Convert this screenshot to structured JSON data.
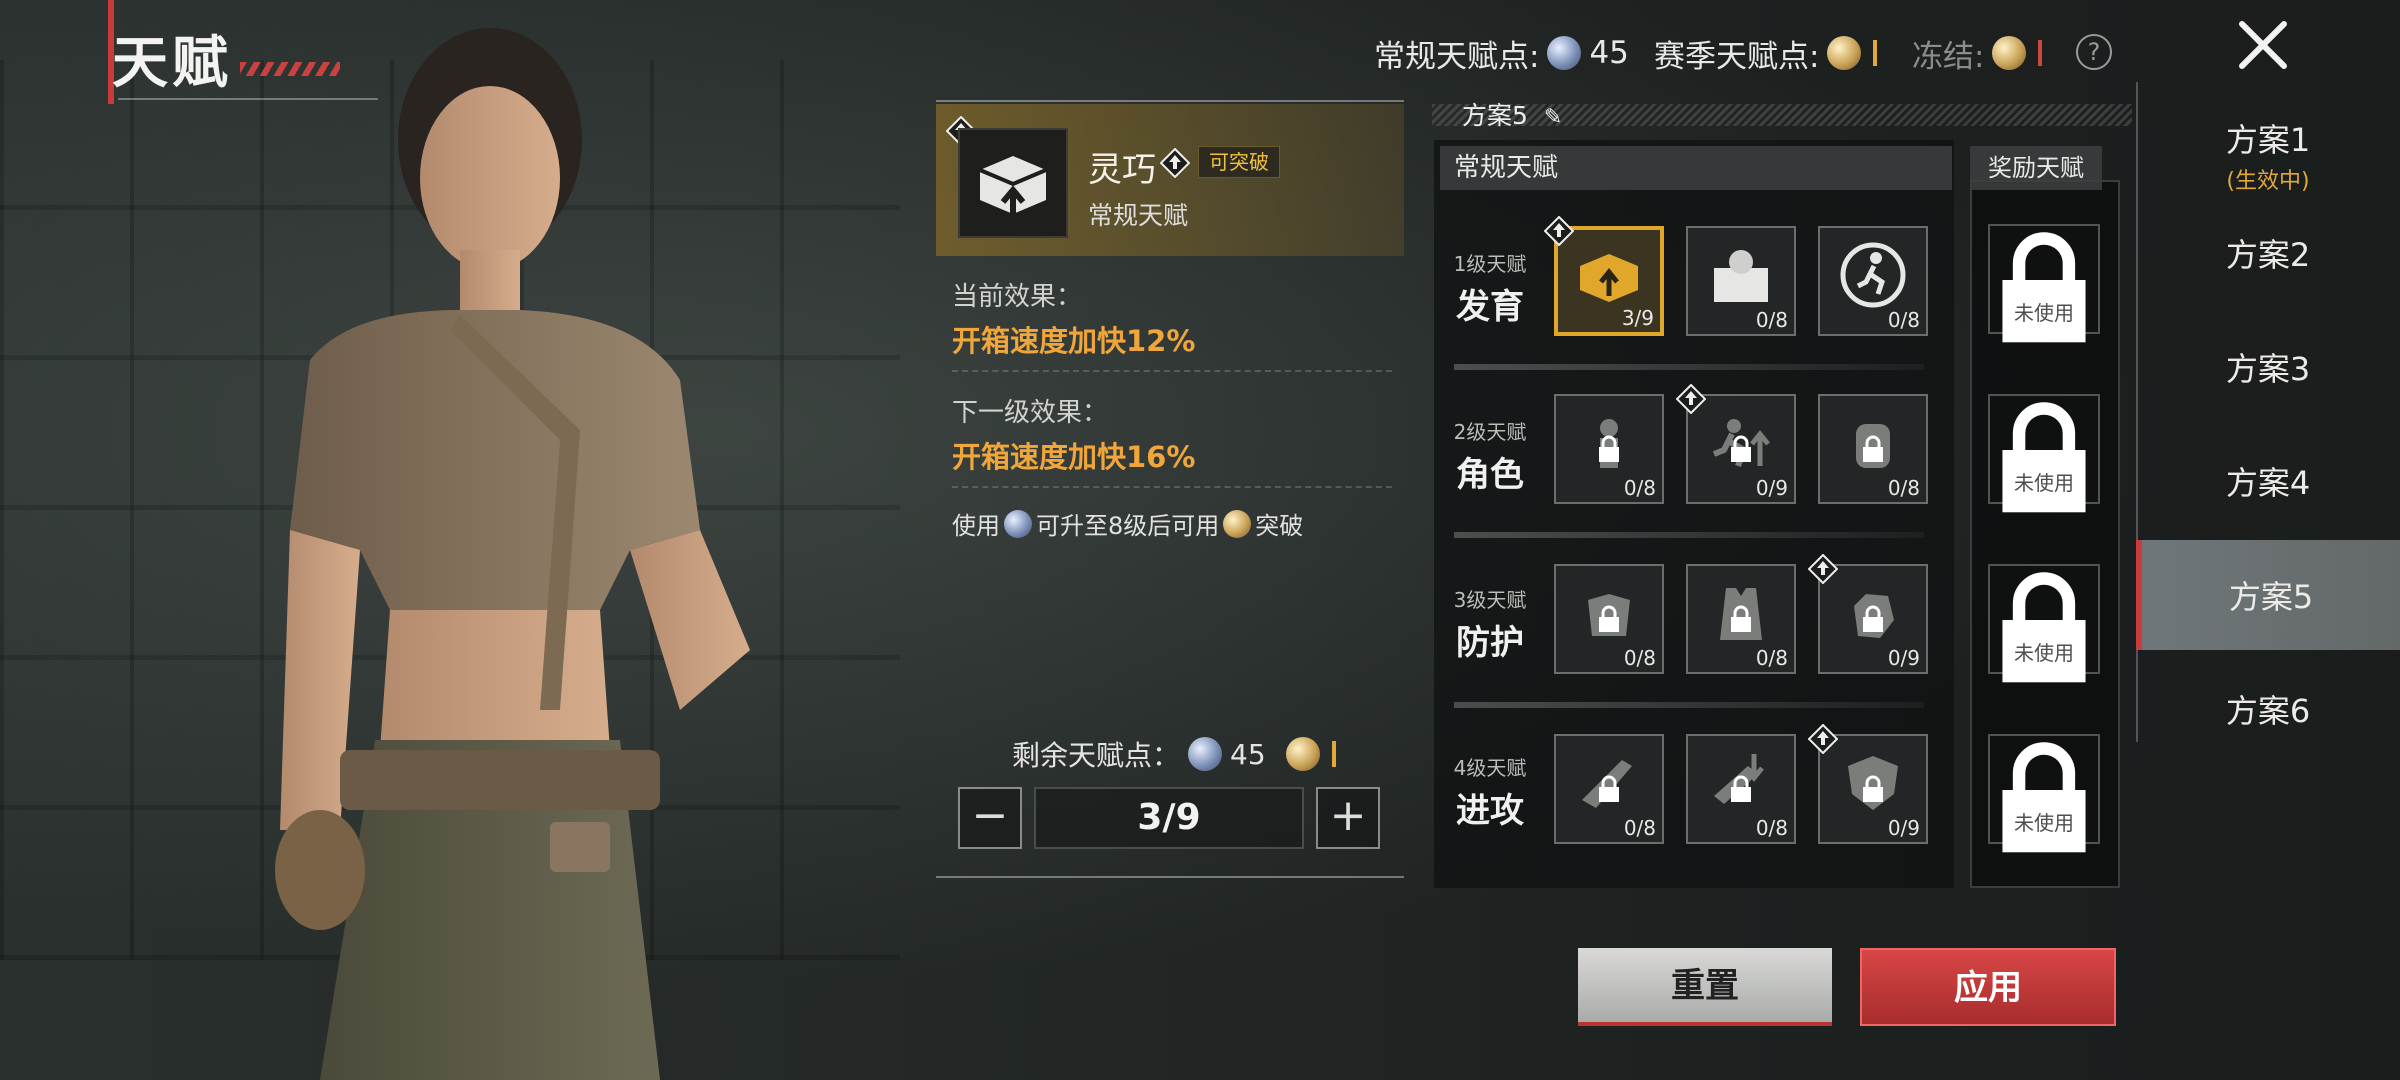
{
  "screen": {
    "title": "天赋"
  },
  "points": {
    "regular_label": "常规天赋点:",
    "regular_value": "45",
    "season_label": "赛季天赋点:",
    "freeze_label": "冻结:",
    "help_symbol": "?"
  },
  "plans": [
    {
      "label": "方案1",
      "sub": "(生效中)"
    },
    {
      "label": "方案2",
      "sub": ""
    },
    {
      "label": "方案3",
      "sub": ""
    },
    {
      "label": "方案4",
      "sub": ""
    },
    {
      "label": "方案5",
      "sub": "",
      "active": true
    },
    {
      "label": "方案6",
      "sub": ""
    }
  ],
  "detail": {
    "name": "灵巧",
    "badge": "可突破",
    "type": "常规天赋",
    "current_label": "当前效果：",
    "current_effect": "开箱速度加快12%",
    "next_label": "下一级效果：",
    "next_effect": "开箱速度加快16%",
    "note_1": "使用",
    "note_2": "可升至8级后可用",
    "note_3": "突破",
    "remain_label": "剩余天赋点：",
    "remain_value": "45",
    "level": "3/9",
    "minus": "−",
    "plus": "+"
  },
  "grid": {
    "plan_name": "方案5",
    "header": "常规天赋",
    "reward_header": "奖励天赋",
    "rows": [
      {
        "level": "1级天赋",
        "name": "发育",
        "nodes": [
          {
            "count": "3/9",
            "icon": "supply-crate-icon",
            "selected": true,
            "locked": false,
            "breakable": true
          },
          {
            "count": "0/8",
            "icon": "loot-chest-icon",
            "selected": false,
            "locked": false,
            "breakable": false
          },
          {
            "count": "0/8",
            "icon": "runner-icon",
            "selected": false,
            "locked": false,
            "breakable": false
          }
        ]
      },
      {
        "level": "2级天赋",
        "name": "角色",
        "nodes": [
          {
            "count": "0/8",
            "icon": "soldier-sound-icon",
            "selected": false,
            "locked": true,
            "breakable": false
          },
          {
            "count": "0/9",
            "icon": "sprint-icon",
            "selected": false,
            "locked": true,
            "breakable": true
          },
          {
            "count": "0/8",
            "icon": "backpack-icon",
            "selected": false,
            "locked": true,
            "breakable": false
          }
        ]
      },
      {
        "level": "3级天赋",
        "name": "防护",
        "nodes": [
          {
            "count": "0/8",
            "icon": "armor-up-icon",
            "selected": false,
            "locked": true,
            "breakable": false
          },
          {
            "count": "0/8",
            "icon": "vest-icon",
            "selected": false,
            "locked": true,
            "breakable": false
          },
          {
            "count": "0/9",
            "icon": "glove-icon",
            "selected": false,
            "locked": true,
            "breakable": true
          }
        ]
      },
      {
        "level": "4级天赋",
        "name": "进攻",
        "nodes": [
          {
            "count": "0/8",
            "icon": "rifle-icon",
            "selected": false,
            "locked": true,
            "breakable": false
          },
          {
            "count": "0/8",
            "icon": "weapon-down-icon",
            "selected": false,
            "locked": true,
            "breakable": false
          },
          {
            "count": "0/9",
            "icon": "shield-icon",
            "selected": false,
            "locked": true,
            "breakable": true
          }
        ]
      }
    ],
    "reward_nodes": [
      {
        "label": "未使用"
      },
      {
        "label": "未使用"
      },
      {
        "label": "未使用"
      },
      {
        "label": "未使用"
      }
    ]
  },
  "buttons": {
    "reset": "重置",
    "apply": "应用"
  },
  "colors": {
    "accent_gold": "#e0a72a",
    "accent_red": "#c83c3c",
    "effect_orange": "#f0a63a"
  }
}
